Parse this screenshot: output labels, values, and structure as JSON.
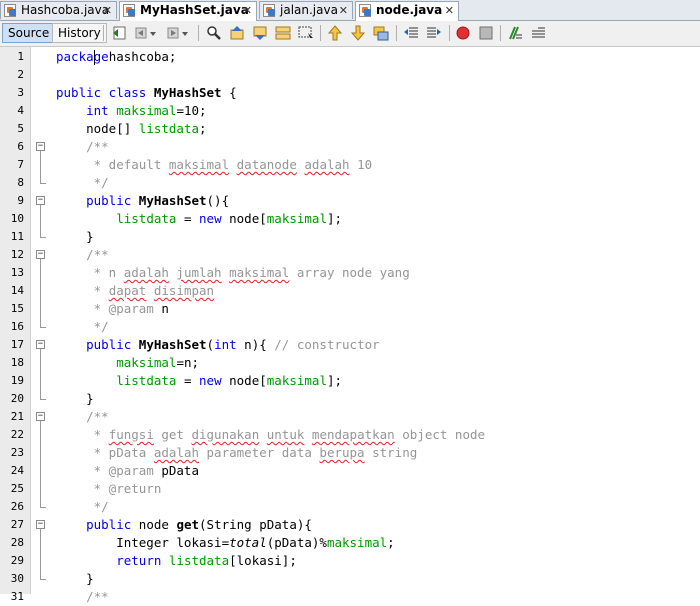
{
  "tabs": [
    {
      "label": "Hashcoba.java",
      "active": false
    },
    {
      "label": "MyHashSet.java",
      "active": true
    },
    {
      "label": "jalan.java",
      "active": false
    },
    {
      "label": "node.java",
      "active": true
    }
  ],
  "toolbar": {
    "source_label": "Source",
    "history_label": "History",
    "icons": [
      "last-edit-icon",
      "back-icon",
      "forward-icon",
      "find-icon",
      "find-previous-icon",
      "find-next-icon",
      "find-selection-icon",
      "toggle-highlight-icon",
      "prev-bookmark-icon",
      "next-bookmark-icon",
      "toggle-bookmark-icon",
      "shift-left-icon",
      "shift-right-icon",
      "start-macro-icon",
      "stop-macro-icon",
      "comment-icon",
      "uncomment-icon"
    ]
  },
  "colors": {
    "keyword": "#0000e6",
    "field": "#009900",
    "comment": "#969696",
    "squiggle": "#e02020"
  },
  "code_lines": [
    {
      "n": "1",
      "parts": [
        [
          "kw",
          "package"
        ],
        [
          "",
          "hashcoba;"
        ]
      ]
    },
    {
      "n": "2",
      "parts": []
    },
    {
      "n": "3",
      "parts": [
        [
          "kw",
          "public class "
        ],
        [
          "bold",
          "MyHashSet"
        ],
        [
          "",
          " {"
        ]
      ]
    },
    {
      "n": "4",
      "parts": [
        [
          "",
          "    "
        ],
        [
          "kw",
          "int "
        ],
        [
          "fld",
          "maksimal"
        ],
        [
          "",
          "=10;"
        ]
      ]
    },
    {
      "n": "5",
      "parts": [
        [
          "",
          "    node[] "
        ],
        [
          "fld",
          "listdata"
        ],
        [
          "",
          ";"
        ]
      ]
    },
    {
      "n": "6",
      "parts": [
        [
          "cm",
          "    /**"
        ]
      ]
    },
    {
      "n": "7",
      "parts": [
        [
          "cm",
          "     * default "
        ],
        [
          "cm sq",
          "maksimal"
        ],
        [
          "cm",
          " "
        ],
        [
          "cm sq",
          "datanode"
        ],
        [
          "cm",
          " "
        ],
        [
          "cm sq",
          "adalah"
        ],
        [
          "cm",
          " 10"
        ]
      ]
    },
    {
      "n": "8",
      "parts": [
        [
          "cm",
          "     */"
        ]
      ]
    },
    {
      "n": "9",
      "parts": [
        [
          "",
          "    "
        ],
        [
          "kw",
          "public "
        ],
        [
          "bold",
          "MyHashSet"
        ],
        [
          "",
          "(){"
        ]
      ]
    },
    {
      "n": "10",
      "parts": [
        [
          "",
          "        "
        ],
        [
          "fld",
          "listdata"
        ],
        [
          "",
          " = "
        ],
        [
          "kw",
          "new "
        ],
        [
          "",
          "node["
        ],
        [
          "fld",
          "maksimal"
        ],
        [
          "",
          "];"
        ]
      ]
    },
    {
      "n": "11",
      "parts": [
        [
          "",
          "    }"
        ]
      ]
    },
    {
      "n": "12",
      "parts": [
        [
          "cm",
          "    /**"
        ]
      ]
    },
    {
      "n": "13",
      "parts": [
        [
          "cm",
          "     * n "
        ],
        [
          "cm sq",
          "adalah"
        ],
        [
          "cm",
          " "
        ],
        [
          "cm sq",
          "jumlah"
        ],
        [
          "cm",
          " "
        ],
        [
          "cm sq",
          "maksimal"
        ],
        [
          "cm",
          " array node yang"
        ]
      ]
    },
    {
      "n": "14",
      "parts": [
        [
          "cm",
          "     * "
        ],
        [
          "cm sq",
          "dapat"
        ],
        [
          "cm",
          " "
        ],
        [
          "cm sq",
          "disimpan"
        ]
      ]
    },
    {
      "n": "15",
      "parts": [
        [
          "cm",
          "     * @param "
        ],
        [
          "",
          "n"
        ]
      ]
    },
    {
      "n": "16",
      "parts": [
        [
          "cm",
          "     */"
        ]
      ]
    },
    {
      "n": "17",
      "parts": [
        [
          "",
          "    "
        ],
        [
          "kw",
          "public "
        ],
        [
          "bold",
          "MyHashSet"
        ],
        [
          "",
          "("
        ],
        [
          "kw",
          "int "
        ],
        [
          "",
          "n){ "
        ],
        [
          "cm",
          "// constructor"
        ]
      ]
    },
    {
      "n": "18",
      "parts": [
        [
          "",
          "        "
        ],
        [
          "fld",
          "maksimal"
        ],
        [
          "",
          "=n;"
        ]
      ]
    },
    {
      "n": "19",
      "parts": [
        [
          "",
          "        "
        ],
        [
          "fld",
          "listdata"
        ],
        [
          "",
          " = "
        ],
        [
          "kw",
          "new "
        ],
        [
          "",
          "node["
        ],
        [
          "fld",
          "maksimal"
        ],
        [
          "",
          "];"
        ]
      ]
    },
    {
      "n": "20",
      "parts": [
        [
          "",
          "    }"
        ]
      ]
    },
    {
      "n": "21",
      "parts": [
        [
          "cm",
          "    /**"
        ]
      ]
    },
    {
      "n": "22",
      "parts": [
        [
          "cm",
          "     * "
        ],
        [
          "cm sq",
          "fungsi"
        ],
        [
          "cm",
          " get "
        ],
        [
          "cm sq",
          "digunakan"
        ],
        [
          "cm",
          " "
        ],
        [
          "cm sq",
          "untuk"
        ],
        [
          "cm",
          " "
        ],
        [
          "cm sq",
          "mendapatkan"
        ],
        [
          "cm",
          " object node"
        ]
      ]
    },
    {
      "n": "23",
      "parts": [
        [
          "cm",
          "     * pData "
        ],
        [
          "cm sq",
          "adalah"
        ],
        [
          "cm",
          " parameter data "
        ],
        [
          "cm sq",
          "berupa"
        ],
        [
          "cm",
          " string"
        ]
      ]
    },
    {
      "n": "24",
      "parts": [
        [
          "cm",
          "     * @param "
        ],
        [
          "",
          "pData"
        ]
      ]
    },
    {
      "n": "25",
      "parts": [
        [
          "cm",
          "     * @return"
        ]
      ]
    },
    {
      "n": "26",
      "parts": [
        [
          "cm",
          "     */"
        ]
      ]
    },
    {
      "n": "27",
      "parts": [
        [
          "",
          "    "
        ],
        [
          "kw",
          "public "
        ],
        [
          "",
          "node "
        ],
        [
          "bold",
          "get"
        ],
        [
          "",
          "(String pData){"
        ]
      ]
    },
    {
      "n": "28",
      "parts": [
        [
          "",
          "        Integer lokasi="
        ],
        [
          "ital",
          "total"
        ],
        [
          "",
          "(pData)%"
        ],
        [
          "fld",
          "maksimal"
        ],
        [
          "",
          ";"
        ]
      ]
    },
    {
      "n": "29",
      "parts": [
        [
          "",
          "        "
        ],
        [
          "kw",
          "return "
        ],
        [
          "fld",
          "listdata"
        ],
        [
          "",
          "[lokasi];"
        ]
      ]
    },
    {
      "n": "30",
      "parts": [
        [
          "",
          "    }"
        ]
      ]
    },
    {
      "n": "31",
      "parts": [
        [
          "cm",
          "    /**"
        ]
      ]
    }
  ]
}
